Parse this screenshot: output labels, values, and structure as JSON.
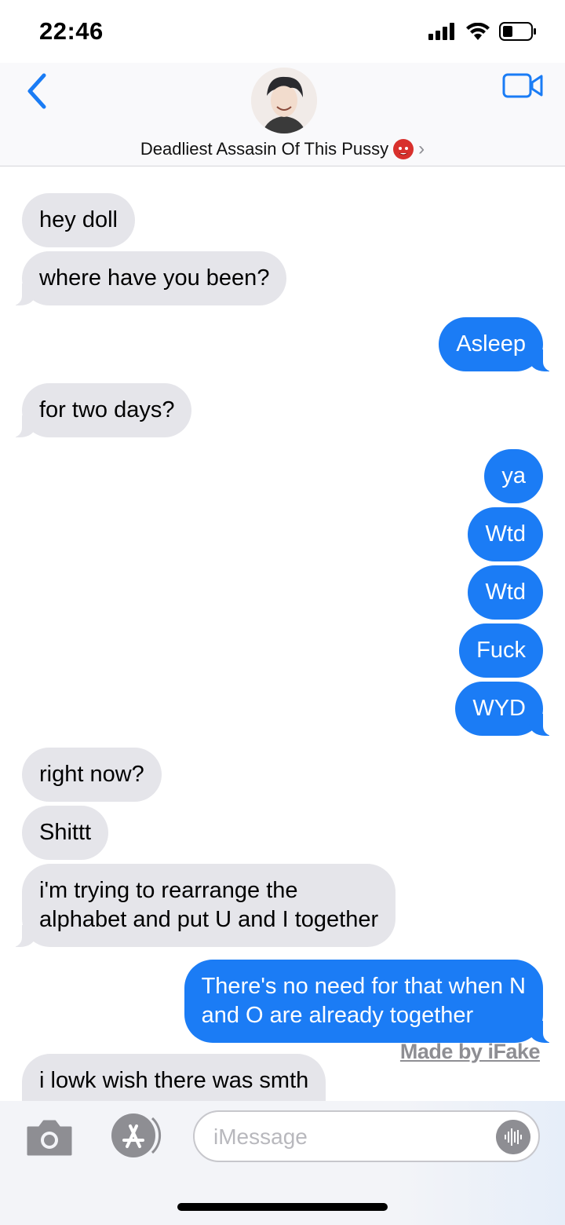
{
  "status_bar": {
    "time": "22:46"
  },
  "header": {
    "contact_name": "Deadliest Assasin Of This Pussy",
    "contact_emoji": "devil-face-icon"
  },
  "messages": [
    {
      "dir": "in",
      "text": "hey doll"
    },
    {
      "dir": "in",
      "text": "where have you been?"
    },
    {
      "dir": "out",
      "text": "Asleep"
    },
    {
      "dir": "in",
      "text": "for two days?"
    },
    {
      "dir": "out",
      "text": "ya"
    },
    {
      "dir": "out",
      "text": "Wtd"
    },
    {
      "dir": "out",
      "text": "Wtd"
    },
    {
      "dir": "out",
      "text": "Fuck"
    },
    {
      "dir": "out",
      "text": "WYD"
    },
    {
      "dir": "in",
      "text": "right now?"
    },
    {
      "dir": "in",
      "text": "Shittt"
    },
    {
      "dir": "in",
      "lines": [
        "i'm trying to rearrange the",
        "alphabet and put U and I together"
      ]
    },
    {
      "dir": "out",
      "lines": [
        "There's no need for that when N",
        "and O are already together"
      ]
    },
    {
      "dir": "in",
      "text": "i lowk wish there was smth"
    }
  ],
  "watermark": "Made by iFake",
  "composer": {
    "placeholder": "iMessage",
    "value": ""
  },
  "colors": {
    "incoming_bubble": "#e5e5ea",
    "outgoing_bubble": "#1b7cf5",
    "accent": "#1a7cf5"
  }
}
